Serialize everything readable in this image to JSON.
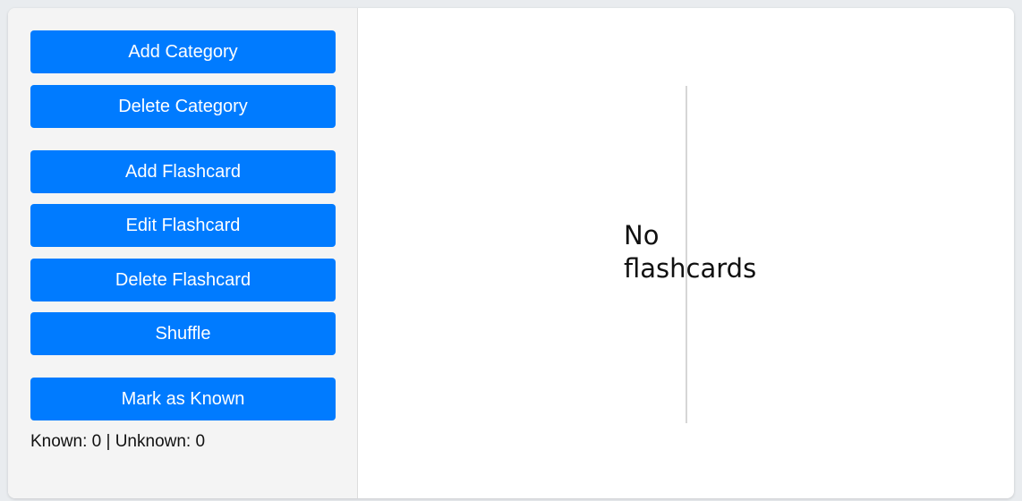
{
  "sidebar": {
    "buttons": {
      "add_category": "Add Category",
      "delete_category": "Delete Category",
      "add_flashcard": "Add Flashcard",
      "edit_flashcard": "Edit Flashcard",
      "delete_flashcard": "Delete Flashcard",
      "shuffle": "Shuffle",
      "mark_known": "Mark as Known"
    },
    "status": "Known: 0 | Unknown: 0"
  },
  "main": {
    "card_text": "No flashcards"
  },
  "colors": {
    "accent": "#007bff",
    "sidebar_bg": "#f4f4f4",
    "page_bg": "#e9ecef"
  }
}
